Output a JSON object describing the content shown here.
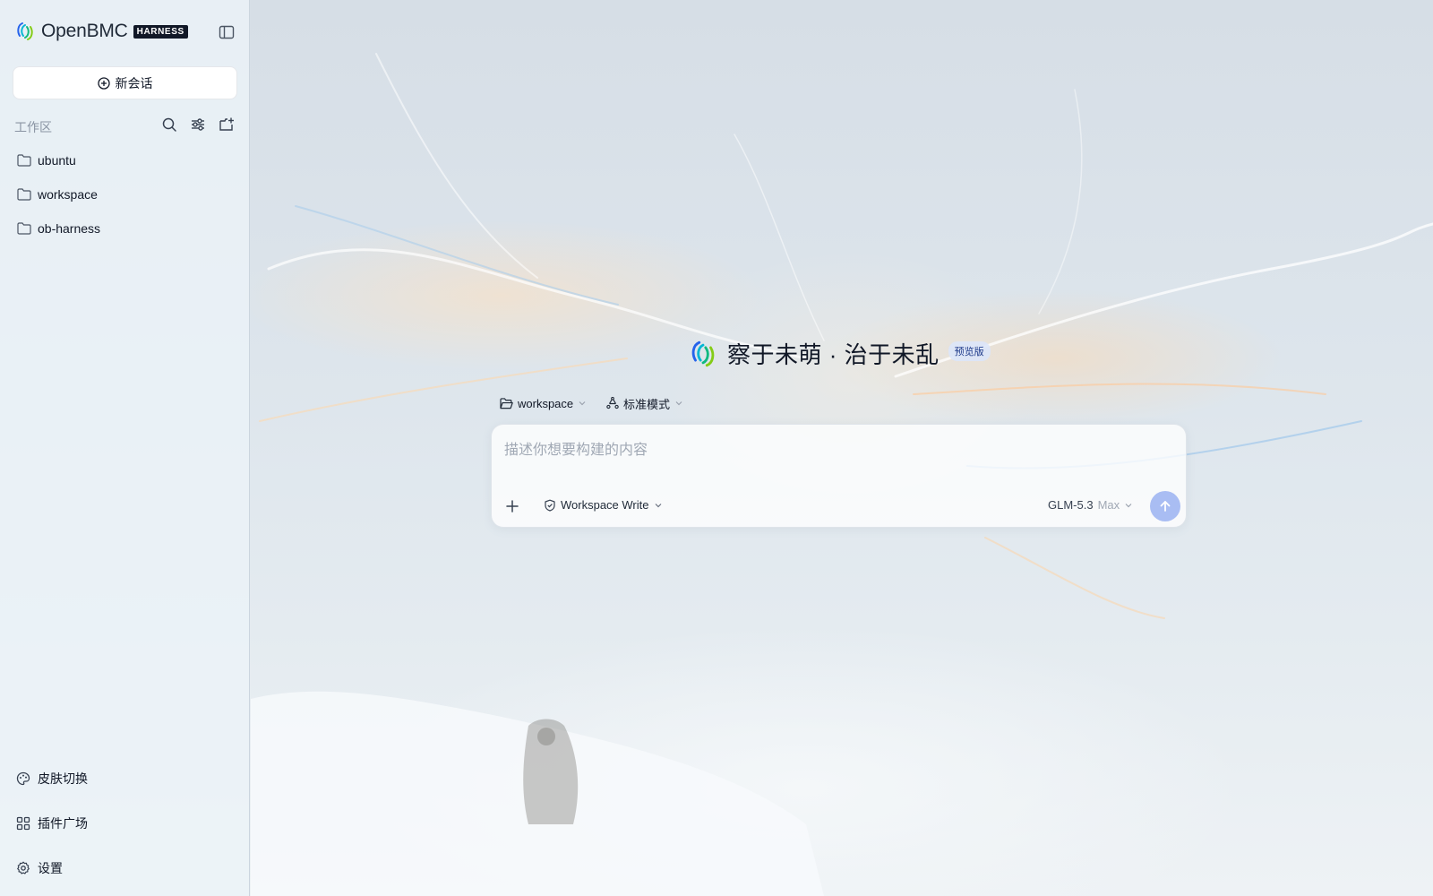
{
  "brand": {
    "name": "OpenBMC",
    "badge": "HARNESS"
  },
  "sidebar": {
    "new_chat_label": "新会话",
    "workspace_label": "工作区",
    "folders": [
      "ubuntu",
      "workspace",
      "ob-harness"
    ],
    "bottom": {
      "skin": "皮肤切换",
      "plugins": "插件广场",
      "settings": "设置"
    }
  },
  "hero": {
    "title": "察于未萌 · 治于未乱",
    "badge": "预览版"
  },
  "toolbar": {
    "workspace": "workspace",
    "mode": "标准模式"
  },
  "composer": {
    "placeholder": "描述你想要构建的内容",
    "permission": "Workspace Write",
    "model": "GLM-5.3",
    "model_level": "Max"
  },
  "colors": {
    "accent": "#a9bdf3",
    "badge_bg": "#111827"
  }
}
